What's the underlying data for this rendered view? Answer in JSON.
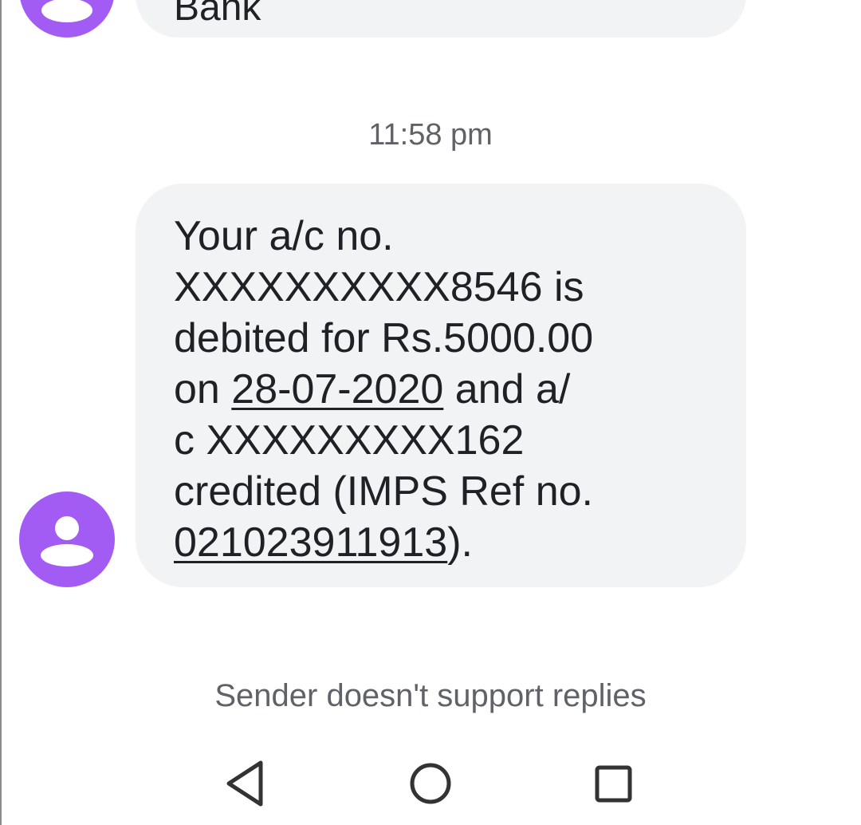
{
  "colors": {
    "avatar": "#a25cf3",
    "bubble": "#f1f3f4",
    "text": "#202124",
    "secondary_text": "#5f6368"
  },
  "conversation": {
    "previous_message": {
      "partial_text": "Bank",
      "avatar_icon": "person-icon"
    },
    "timestamp": "11:58 pm",
    "message": {
      "avatar_icon": "person-icon",
      "line1": "Your a/c no.",
      "line2": "XXXXXXXXXX8546 is",
      "line3": "debited for Rs.5000.00",
      "line4_prefix": "on ",
      "line4_date": "28-07-2020",
      "line4_suffix": " and a/",
      "line5": "c XXXXXXXXX162",
      "line6": "credited (IMPS Ref no.",
      "line7_ref": "021023911913",
      "line7_suffix": ")."
    },
    "reply_notice": "Sender doesn't support replies"
  },
  "navigation_bar": {
    "buttons": [
      {
        "name": "back",
        "icon": "back-triangle-icon"
      },
      {
        "name": "home",
        "icon": "home-circle-icon"
      },
      {
        "name": "recents",
        "icon": "recents-square-icon"
      }
    ]
  }
}
